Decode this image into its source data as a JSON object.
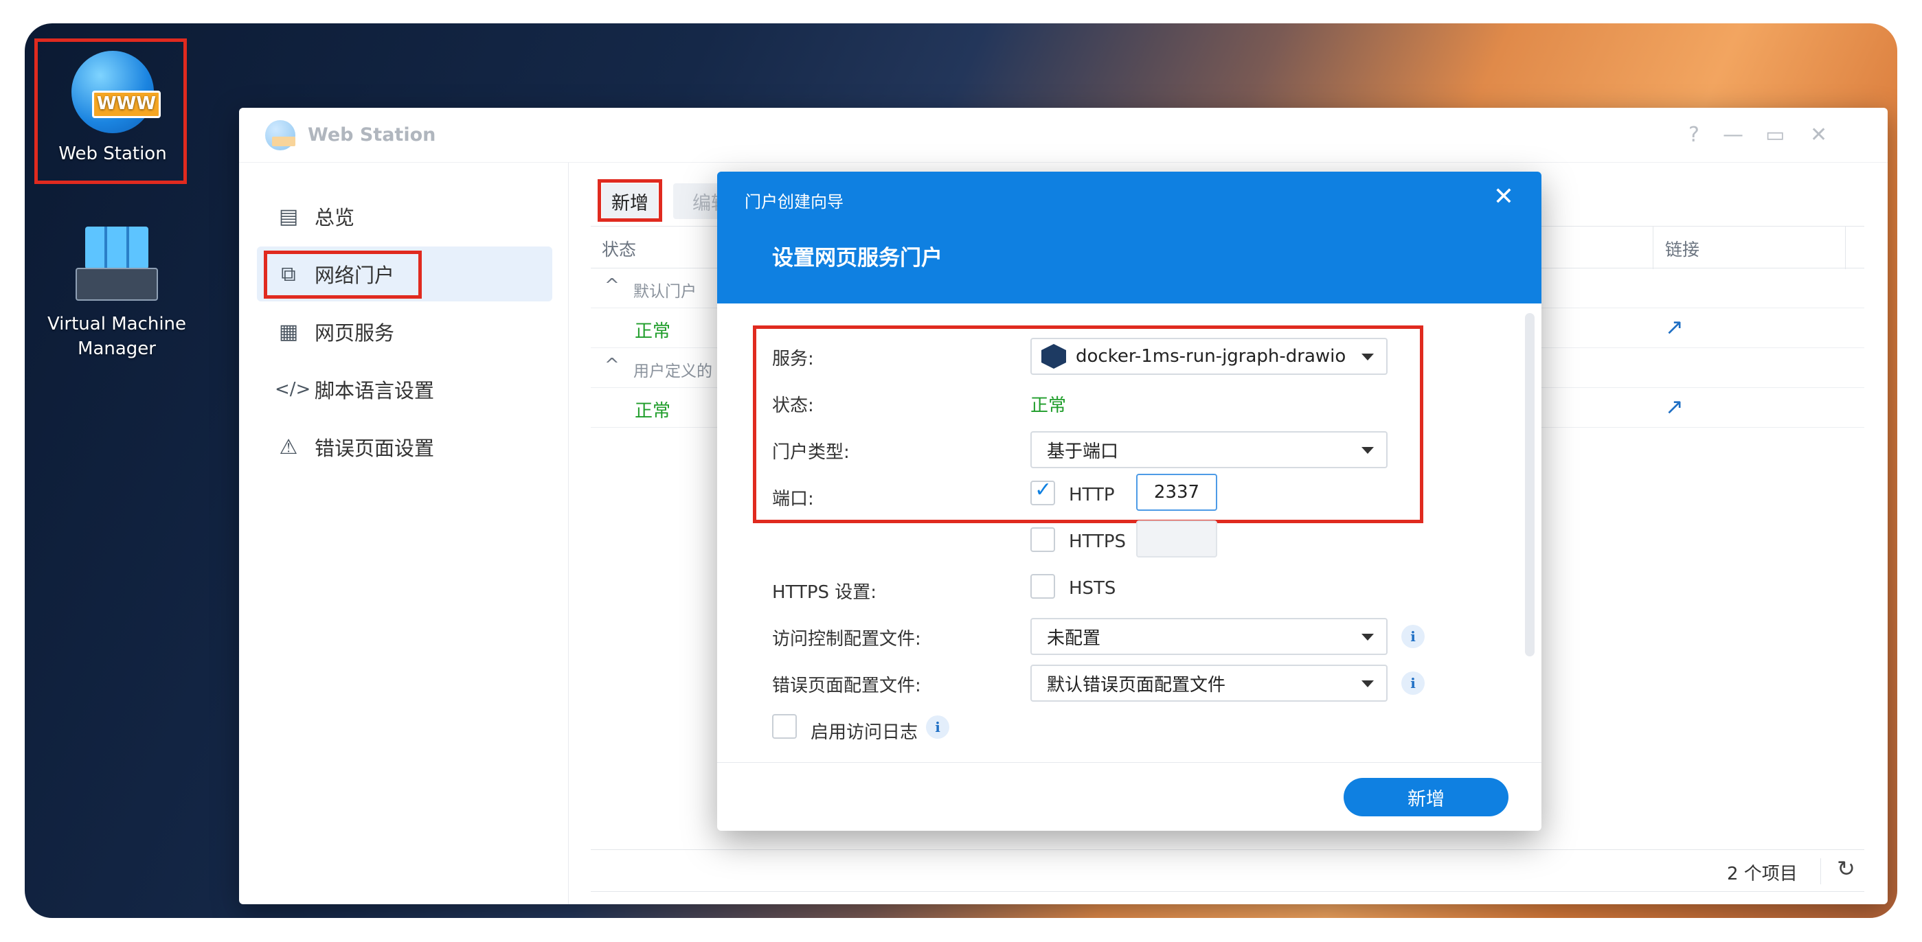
{
  "desktop": {
    "web_station_label": "Web Station",
    "web_station_badge": "WWW",
    "vmm_label_line1": "Virtual Machine",
    "vmm_label_line2": "Manager"
  },
  "window": {
    "title": "Web Station",
    "help": "?",
    "minimize": "—",
    "maximize": "▭",
    "close": "✕"
  },
  "sidebar": {
    "items": [
      {
        "label": "总览",
        "icon": "overview-icon"
      },
      {
        "label": "网络门户",
        "icon": "portal-icon"
      },
      {
        "label": "网页服务",
        "icon": "grid-icon"
      },
      {
        "label": "脚本语言设置",
        "icon": "code-icon"
      },
      {
        "label": "错误页面设置",
        "icon": "alert-icon"
      }
    ]
  },
  "toolbar": {
    "add_label": "新增",
    "edit_label": "编辑"
  },
  "table": {
    "col_status": "状态",
    "col_link": "链接",
    "group_default": "默认门户",
    "group_user": "用户定义的",
    "rows": [
      {
        "status": "正常"
      },
      {
        "status": "正常"
      }
    ],
    "footer_count": "2 个项目"
  },
  "dialog": {
    "title": "门户创建向导",
    "subtitle": "设置网页服务门户",
    "service_label": "服务:",
    "service_value": "docker-1ms-run-jgraph-drawio",
    "status_label": "状态:",
    "status_value": "正常",
    "portal_type_label": "门户类型:",
    "portal_type_value": "基于端口",
    "port_label": "端口:",
    "http_label": "HTTP",
    "http_port": "2337",
    "https_label": "HTTPS",
    "https_port": "",
    "https_settings_label": "HTTPS 设置:",
    "hsts_label": "HSTS",
    "access_control_label": "访问控制配置文件:",
    "access_control_value": "未配置",
    "error_page_label": "错误页面配置文件:",
    "error_page_value": "默认错误页面配置文件",
    "access_log_label": "启用访问日志",
    "submit_label": "新增"
  },
  "colors": {
    "accent": "#0f80e1",
    "highlight": "#e02a1f",
    "status_ok": "#1f9d2a"
  }
}
